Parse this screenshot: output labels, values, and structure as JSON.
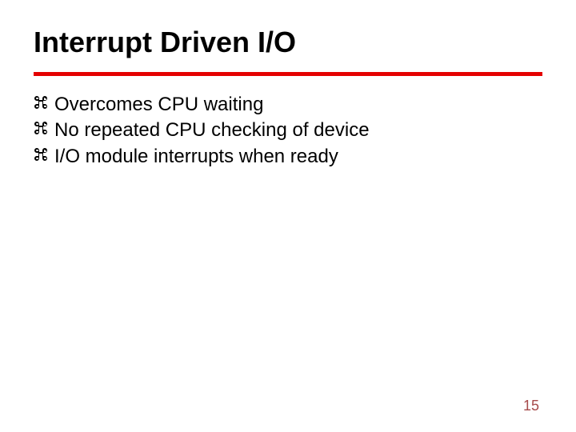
{
  "slide": {
    "title": "Interrupt Driven I/O",
    "bullets": [
      "Overcomes CPU waiting",
      "No repeated CPU checking of device",
      "I/O module interrupts when ready"
    ],
    "page_number": "15"
  }
}
